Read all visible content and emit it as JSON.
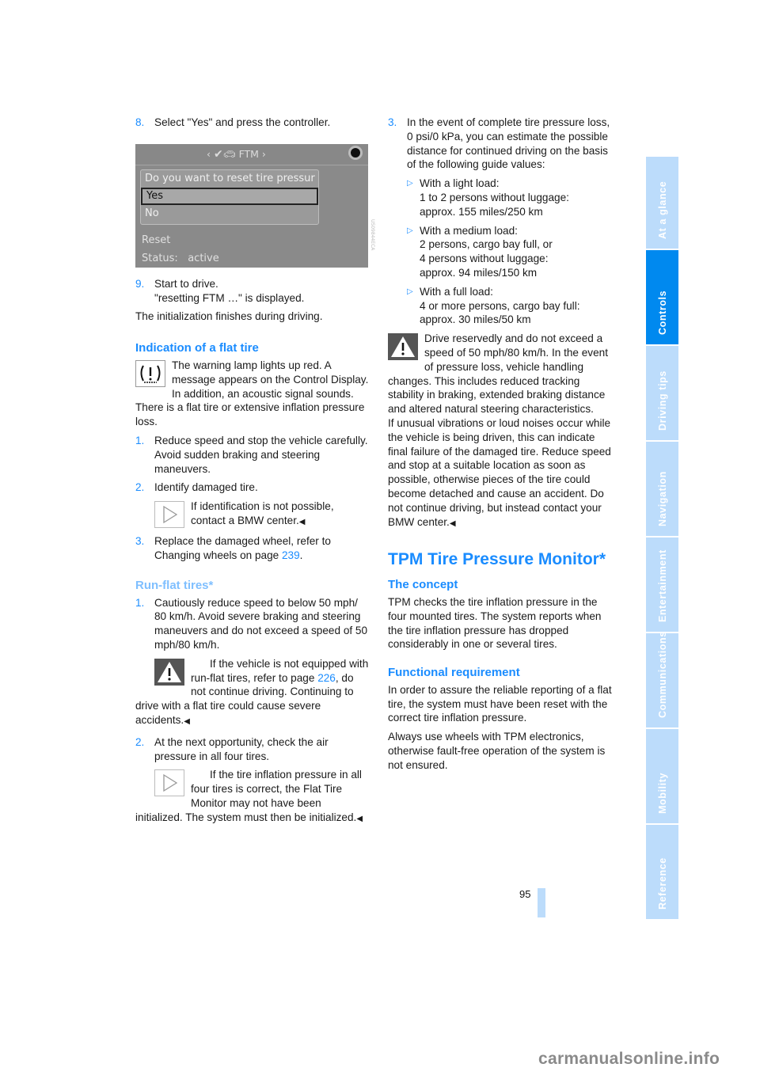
{
  "left": {
    "step8": {
      "num": "8.",
      "text": "Select \"Yes\" and press the controller."
    },
    "display": {
      "title": "FTM",
      "question": "Do you want to reset tire pressur",
      "options": [
        "Yes",
        "No"
      ],
      "selected": "Yes",
      "reset_label": "Reset",
      "status_label": "Status:",
      "status_value": "active",
      "image_code": "US09844ECA"
    },
    "step9": {
      "num": "9.",
      "line1": "Start to drive.",
      "line2": "\"resetting FTM …\" is displayed."
    },
    "init_note": "The initialization finishes during driving.",
    "flat_tire": {
      "heading": "Indication of a flat tire",
      "intro_icon_text": "The warning lamp lights up red. A message appears on the Control Display. In addition, an acoustic signal sounds.",
      "intro_rest": "There is a flat tire or extensive inflation pressure loss.",
      "steps": [
        {
          "num": "1.",
          "text": "Reduce speed and stop the vehicle carefully. Avoid sudden braking and steering maneuvers."
        },
        {
          "num": "2.",
          "text": "Identify damaged tire.",
          "note": "If identification is not possible, contact a BMW center."
        },
        {
          "num": "3.",
          "text_before": "Replace the damaged wheel, refer to Changing wheels on page ",
          "link": "239",
          "text_after": "."
        }
      ]
    },
    "run_flat": {
      "heading": "Run-flat tires*",
      "steps": [
        {
          "num": "1.",
          "text": "Cautiously reduce speed to below 50 mph/ 80 km/h. Avoid severe braking and steering maneuvers and do not exceed a speed of 50 mph/80 km/h.",
          "warning_before": "If the vehicle is not equipped with run-flat tires, refer to page ",
          "warning_link": "226",
          "warning_after": ", do not continue driving. Continuing to drive with a flat tire could cause severe accidents."
        },
        {
          "num": "2.",
          "text": "At the next opportunity, check the air pressure in all four tires.",
          "note": "If the tire inflation pressure in all four tires is correct, the Flat Tire Monitor may not have been initialized. The system must then be initialized."
        }
      ]
    }
  },
  "right": {
    "step3": {
      "num": "3.",
      "text": "In the event of complete tire pressure loss, 0 psi/0 kPa, you can estimate the possible distance for continued driving on the basis of the following guide values:"
    },
    "loads": [
      {
        "label": "With a light load:",
        "lines": [
          "1 to 2 persons without luggage:",
          "approx. 155 miles/250 km"
        ]
      },
      {
        "label": "With a medium load:",
        "lines": [
          "2 persons, cargo bay full, or",
          "4 persons without luggage:",
          "approx. 94 miles/150 km"
        ]
      },
      {
        "label": "With a full load:",
        "lines": [
          "4 or more persons, cargo bay full:",
          "approx. 30 miles/50 km"
        ]
      }
    ],
    "warning1": "Drive reservedly and do not exceed a speed of 50 mph/80 km/h. In the event of pressure loss, vehicle handling changes. This includes reduced tracking stability in braking, extended braking distance and altered natural steering characteristics.",
    "warning2": "If unusual vibrations or loud noises occur while the vehicle is being driven, this can indicate final failure of the damaged tire. Reduce speed and stop at a suitable location as soon as possible, otherwise pieces of the tire could become detached and cause an accident. Do not continue driving, but instead contact your BMW center.",
    "tpm": {
      "heading": "TPM Tire Pressure Monitor*",
      "concept_heading": "The concept",
      "concept_text": "TPM checks the tire inflation pressure in the four mounted tires. The system reports when the tire inflation pressure has dropped considerably in one or several tires.",
      "func_heading": "Functional requirement",
      "func_text1": "In order to assure the reliable reporting of a flat tire, the system must have been reset with the correct tire inflation pressure.",
      "func_text2": "Always use wheels with TPM electronics, otherwise fault-free operation of the system is not ensured."
    }
  },
  "endmark": "◀",
  "side_tabs": [
    {
      "label": "At a glance",
      "active": false
    },
    {
      "label": "Controls",
      "active": true
    },
    {
      "label": "Driving tips",
      "active": false
    },
    {
      "label": "Navigation",
      "active": false
    },
    {
      "label": "Entertainment",
      "active": false
    },
    {
      "label": "Communications",
      "active": false
    },
    {
      "label": "Mobility",
      "active": false
    },
    {
      "label": "Reference",
      "active": false
    }
  ],
  "page_number": "95",
  "watermark": "carmanualsonline.info",
  "colors": {
    "accent": "#1a8cff",
    "tab_active": "#0089ef",
    "tab_inactive": "#bcdcfb"
  }
}
